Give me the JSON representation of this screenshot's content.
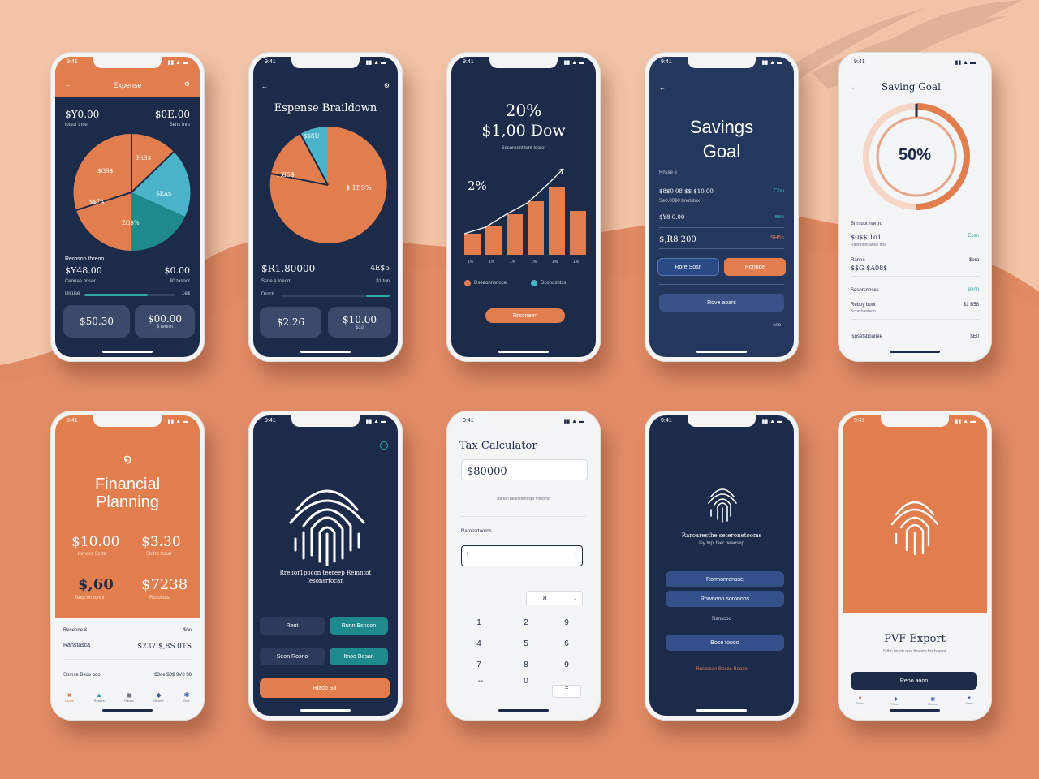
{
  "colors": {
    "background": "#f2c3a6",
    "navy": "#1d2b4a",
    "orange": "#e27d4e",
    "teal": "#2fa6a6",
    "light_blue": "#4ab3c9",
    "white": "#f4f5f7"
  },
  "p1": {
    "title": "Expense",
    "left_amount": "$Y0.00",
    "right_amount": "$0E.00",
    "left_sub": "lotsor tncer",
    "right_sub": "Sens fnrs",
    "slice_labels": [
      "$GS$",
      "HtS$",
      "$$7A",
      "SEA$",
      "ZG$%"
    ],
    "section_label": "Rerosop threon",
    "total": "$Y48.00",
    "total_right": "$0.00",
    "total_sub": "Ceonae bosor",
    "total_sub_right": "$0 tasoor",
    "bar_label": "Dixuse",
    "bar_value": "1e$",
    "progress": 0.7,
    "card1": "$50.30",
    "card2": "$00.00",
    "card2_sub": "$ teorm"
  },
  "p2": {
    "title": "Espense Braildown",
    "slice_labels": [
      "$$SU",
      "1.85$",
      "$ 1ES%"
    ],
    "total": "$R1.80000",
    "total_right": "4E$5",
    "total_sub": "Ssne a toeom",
    "total_sub_right": "$1 ton",
    "bar_label": "Droctl",
    "progress": 0.22,
    "card1": "$2.26",
    "card2": "$10.00",
    "card2_sub": "$1o"
  },
  "p3": {
    "headline1": "20%",
    "headline2": "$1,00 Dow",
    "sub": "Sosoresnt kmt locrer",
    "chart_label": "2%",
    "legend1": "Dseaonnsnoce",
    "legend2": "Dconoshtss",
    "button": "Rrsonaen"
  },
  "p4": {
    "title_line1": "Savings",
    "title_line2": "Goal",
    "section": "Rnsse e",
    "rows": [
      {
        "label": "$8$0 08 $$ $10.00",
        "value": "Cbo"
      },
      {
        "label": "Se0.00$0 bnotstox",
        "value": ""
      },
      {
        "label": "$Y8 0.00",
        "value": "eeo"
      },
      {
        "label": "$,R8 200",
        "value": "SH5s"
      }
    ],
    "btn_left": "Rore Sosn",
    "btn_right": "Ronnce",
    "wide_btn": "Rove aoars",
    "footer_value": "sno"
  },
  "p5": {
    "title": "Saving Goal",
    "percent": "50%",
    "progress": 0.5,
    "section": "Bnrsuot nwrtro",
    "rows": [
      {
        "label": "$0$$ 1o1.",
        "sub": "Raebonfo anoe bos",
        "value": "Ecen"
      },
      {
        "label": "Ranne",
        "sub": "$$G $A08$",
        "value": "$ora"
      },
      {
        "label": "Sesorsnoses",
        "sub": "",
        "value": "$R00"
      },
      {
        "label": "Reboy boot",
        "sub": "Scon banteon",
        "value": "$1 B58"
      },
      {
        "label": "Isnsetsboanee",
        "sub": "",
        "value": "$E0"
      }
    ]
  },
  "p6": {
    "title_line1": "Financial",
    "title_line2": "Planning",
    "stats": [
      {
        "value": "$10.00",
        "sub": "benonr Sorte"
      },
      {
        "value": "$3.30",
        "sub": "Stofro torun"
      },
      {
        "value": "$,60",
        "sub": "Texp brt torex"
      },
      {
        "value": "$7238",
        "sub": "Rssostas"
      }
    ],
    "row1_label": "Reseone &",
    "row1_value": "$0o",
    "row2_label": "Ranstasca",
    "row2_value": "$237 $,8S.0TS",
    "row3_label": "Somse Beco boo",
    "row3_value": "$3oe $0$ 9V0 $0",
    "tabs": [
      "Lsone",
      "Reaurs",
      "Raoon",
      "Rrrone",
      "Sror"
    ]
  },
  "p7": {
    "text_line1": "Rreuor1pocon teereep Remntot",
    "text_line2": "Iesonsrfocan",
    "btn1": "Rent",
    "btn2": "Runn Bsnoon",
    "btn3": "Seon Rosno",
    "btn4": "Itnoo Besan",
    "main_btn": "Riaoo Sa"
  },
  "p8": {
    "title": "Tax Calculator",
    "amount": "$80000",
    "sub": "Ba ton beansfenospt fnrnomd",
    "section": "Rarossrtooros",
    "input_value": "I",
    "select_value": "8",
    "keys": [
      "1",
      "2",
      "9",
      "4",
      "5",
      "6",
      "7",
      "8",
      "9",
      "--",
      "0",
      "="
    ]
  },
  "p9": {
    "text_line1": "Raroaresthe seteronetooms",
    "text_line2": "Isy tnpl feer beansep",
    "btn1": "Rormonronsse",
    "btn2": "Rownooo soronoos",
    "mid_text": "Ranscoo",
    "btn3": "Bose toooo",
    "link": "Rosoroae Beoze Beoze"
  },
  "p10": {
    "title": "PVF Export",
    "sub": "Srtbo honrb reor lt nesto fos boproit",
    "button": "Reoo aoon",
    "tabs": [
      "Bure",
      "Roore",
      "Rosoe",
      "Saen"
    ]
  }
}
